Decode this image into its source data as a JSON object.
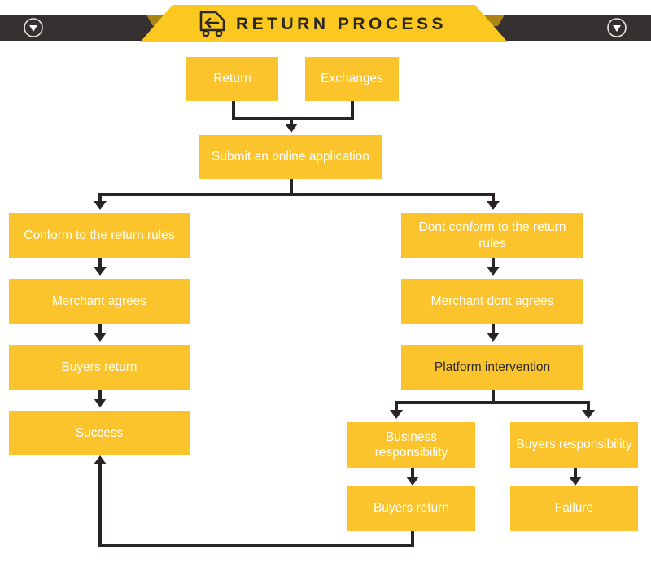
{
  "header": {
    "title": "RETURN PROCESS",
    "truck_icon": "return-truck-icon",
    "left_icon": "chevron-down-circle-icon",
    "right_icon": "chevron-down-circle-icon",
    "banner_color": "#FAC81E",
    "bar_color": "#343130"
  },
  "theme": {
    "node_fill": "#FBC42D",
    "node_text": "#FFFFFF",
    "node_text_dark": "#2D2A29",
    "connector": "#282524",
    "background": "#FFFFFF"
  },
  "flowchart": {
    "type": "flowchart",
    "title": "RETURN PROCESS",
    "nodes": [
      {
        "id": "return",
        "label": "Return",
        "text_style": "light"
      },
      {
        "id": "exchanges",
        "label": "Exchanges",
        "text_style": "light"
      },
      {
        "id": "submit",
        "label": "Submit an online application",
        "text_style": "light"
      },
      {
        "id": "conform",
        "label": "Conform to the return rules",
        "text_style": "light"
      },
      {
        "id": "dont_conform",
        "label": "Dont conform to the return rules",
        "text_style": "light"
      },
      {
        "id": "merchant_agrees",
        "label": "Merchant agrees",
        "text_style": "light"
      },
      {
        "id": "merchant_dont",
        "label": "Merchant dont agrees",
        "text_style": "light"
      },
      {
        "id": "buyers_return_l",
        "label": "Buyers return",
        "text_style": "light"
      },
      {
        "id": "platform",
        "label": "Platform intervention",
        "text_style": "dark"
      },
      {
        "id": "success",
        "label": "Success",
        "text_style": "light"
      },
      {
        "id": "business_resp",
        "label": "Business responsibility",
        "text_style": "light"
      },
      {
        "id": "buyers_resp",
        "label": "Buyers responsibility",
        "text_style": "light"
      },
      {
        "id": "buyers_return_r",
        "label": "Buyers return",
        "text_style": "light"
      },
      {
        "id": "failure",
        "label": "Failure",
        "text_style": "light"
      }
    ],
    "edges": [
      {
        "from": "return",
        "to": "submit"
      },
      {
        "from": "exchanges",
        "to": "submit"
      },
      {
        "from": "submit",
        "to": "conform"
      },
      {
        "from": "submit",
        "to": "dont_conform"
      },
      {
        "from": "conform",
        "to": "merchant_agrees"
      },
      {
        "from": "merchant_agrees",
        "to": "buyers_return_l"
      },
      {
        "from": "buyers_return_l",
        "to": "success"
      },
      {
        "from": "dont_conform",
        "to": "merchant_dont"
      },
      {
        "from": "merchant_dont",
        "to": "platform"
      },
      {
        "from": "platform",
        "to": "business_resp"
      },
      {
        "from": "platform",
        "to": "buyers_resp"
      },
      {
        "from": "business_resp",
        "to": "buyers_return_r"
      },
      {
        "from": "buyers_resp",
        "to": "failure"
      },
      {
        "from": "buyers_return_r",
        "to": "success"
      }
    ]
  }
}
